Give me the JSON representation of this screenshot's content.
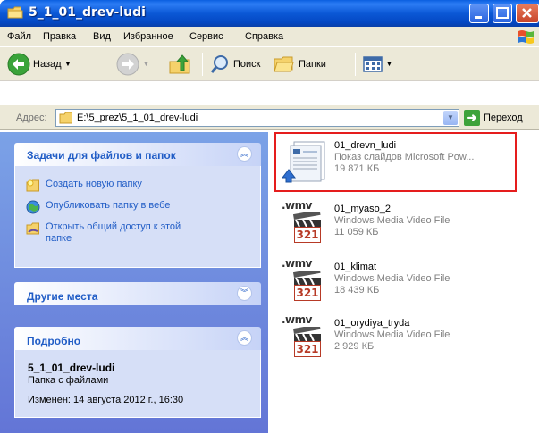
{
  "window": {
    "title": "5_1_01_drev-ludi"
  },
  "menu": {
    "items": [
      "Файл",
      "Правка",
      "Вид",
      "Избранное",
      "Сервис",
      "Справка"
    ]
  },
  "toolbar": {
    "back_label": "Назад",
    "search_label": "Поиск",
    "folders_label": "Папки"
  },
  "address": {
    "label": "Адрес:",
    "path": "E:\\5_prez\\5_1_01_drev-ludi",
    "go_label": "Переход"
  },
  "tasks_panel": {
    "title": "Задачи для файлов и папок",
    "items": [
      {
        "label": "Создать новую папку",
        "icon": "new-folder-icon"
      },
      {
        "label": "Опубликовать папку в вебе",
        "icon": "publish-web-icon"
      },
      {
        "label": "Открыть общий доступ к этой папке",
        "icon": "share-folder-icon"
      }
    ]
  },
  "other_places_panel": {
    "title": "Другие места"
  },
  "details_panel": {
    "title": "Подробно",
    "folder_name": "5_1_01_drev-ludi",
    "folder_type": "Папка с файлами",
    "modified": "Изменен: 14 августа 2012 г., 16:30"
  },
  "files": [
    {
      "name": "01_drevn_ludi",
      "type": "Показ слайдов Microsoft Pow...",
      "size": "19 871 КБ",
      "icon": "powerpoint-show-icon"
    },
    {
      "name": "01_myaso_2",
      "type": "Windows Media Video File",
      "size": "11 059 КБ",
      "icon": "wmv-file-icon",
      "badge": ".wmv",
      "badge_num": "321"
    },
    {
      "name": "01_klimat",
      "type": "Windows Media Video File",
      "size": "18 439 КБ",
      "icon": "wmv-file-icon",
      "badge": ".wmv",
      "badge_num": "321"
    },
    {
      "name": "01_orydiya_tryda",
      "type": "Windows Media Video File",
      "size": "2 929 КБ",
      "icon": "wmv-file-icon",
      "badge": ".wmv",
      "badge_num": "321"
    }
  ],
  "colors": {
    "title_bar": "#0a58d6",
    "task_link": "#215dc6",
    "left_pane": "#7ba2e7",
    "highlight": "#e51d1d"
  }
}
